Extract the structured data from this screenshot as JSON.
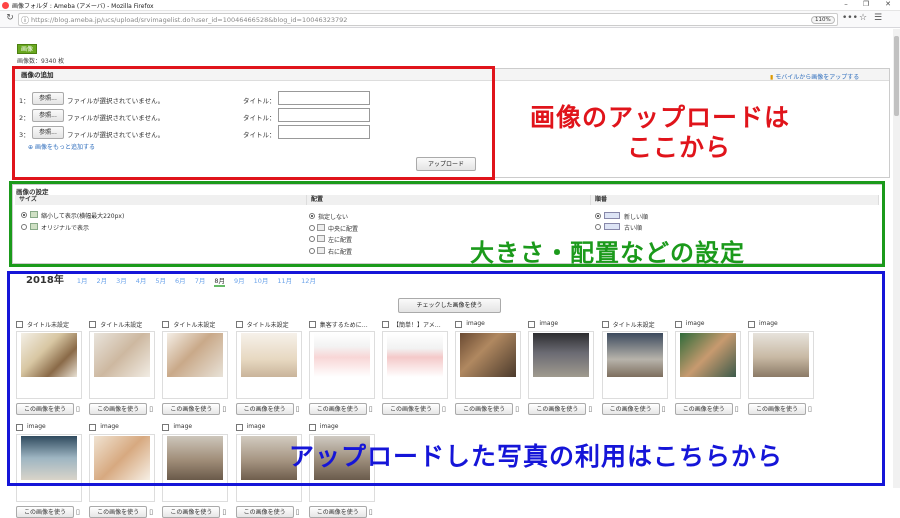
{
  "window": {
    "title": "画像フォルダ : Ameba (アメーバ) - Mozilla Firefox",
    "min": "–",
    "max": "❐",
    "close": "✕"
  },
  "browser": {
    "url": "https://blog.ameba.jp/ucs/upload/srvimagelist.do?user_id=10046466528&blog_id=10046323792",
    "zoom": "110%",
    "back": "←",
    "forward": "→",
    "reload": "↻",
    "more": "•••",
    "pocket": "♡",
    "bookmark": "☆",
    "library": "⫴",
    "sidebar": "▤",
    "menu": "☰"
  },
  "page": {
    "folder_badge": "画像",
    "image_count": "画像数：9340 枚"
  },
  "upload": {
    "heading": "画像の追加",
    "mobile_link": "モバイルから画像をアップする",
    "rows": [
      {
        "num": "1：",
        "browse": "参照...",
        "status": "ファイルが選択されていません。",
        "title_label": "タイトル："
      },
      {
        "num": "2：",
        "browse": "参照...",
        "status": "ファイルが選択されていません。",
        "title_label": "タイトル："
      },
      {
        "num": "3：",
        "browse": "参照...",
        "status": "ファイルが選択されていません。",
        "title_label": "タイトル："
      }
    ],
    "add_more": "画像をもっと追加する",
    "upload_button": "アップロード"
  },
  "settings": {
    "heading": "画像の設定",
    "size_col": "サイズ",
    "align_col": "配置",
    "order_col": "順番",
    "size_options": [
      "縮小して表示(横幅最大220px)",
      "オリジナルで表示"
    ],
    "align_options": [
      "指定しない",
      "中央に配置",
      "左に配置",
      "右に配置"
    ],
    "order_options": [
      "新しい順",
      "古い順"
    ]
  },
  "gallery": {
    "year": "2018年",
    "months": [
      "1月",
      "2月",
      "3月",
      "4月",
      "5月",
      "6月",
      "7月",
      "8月",
      "9月",
      "10月",
      "11月",
      "12月"
    ],
    "current_month": "8月",
    "use_checked": "チェックした画像を使う",
    "use_button": "この画像を使う",
    "row1": [
      {
        "label": "タイトル未設定"
      },
      {
        "label": "タイトル未設定"
      },
      {
        "label": "タイトル未設定"
      },
      {
        "label": "タイトル未設定"
      },
      {
        "label": "集客するために…"
      },
      {
        "label": "【簡単！】アメ…"
      },
      {
        "label": "image"
      },
      {
        "label": "image"
      },
      {
        "label": "タイトル未設定"
      },
      {
        "label": "image"
      },
      {
        "label": "image"
      }
    ],
    "row2": [
      {
        "label": "image"
      },
      {
        "label": "image"
      },
      {
        "label": "image"
      },
      {
        "label": "image"
      },
      {
        "label": "image"
      }
    ]
  },
  "annotations": {
    "upload_note_line1": "画像のアップロードは",
    "upload_note_line2": "ここから",
    "settings_note": "大きさ・配置などの設定",
    "gallery_note": "アップロードした写真の利用はこちらから",
    "red": "#e0141b",
    "green": "#1b9a1b",
    "blue": "#1515d8"
  }
}
